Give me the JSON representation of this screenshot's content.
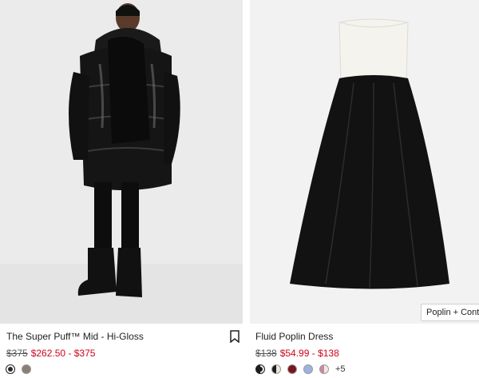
{
  "products": [
    {
      "name": "The Super Puff™ Mid - Hi-Gloss",
      "price_original": "$375",
      "price_sale": "$262.50 - $375",
      "swatches": [
        {
          "color": "#2a2a2a",
          "selected": true
        },
        {
          "color": "#8a7f74",
          "selected": false
        }
      ],
      "bookmark_icon": "bookmark-icon"
    },
    {
      "name": "Fluid Poplin Dress",
      "price_original": "$138",
      "price_sale": "$54.99 - $138",
      "tag": "Poplin + Conto",
      "swatches": [
        {
          "color": "#1c1c1c",
          "color2": "#f0ece4",
          "selected": true
        },
        {
          "color": "#1c1c1c",
          "color2": "#efe6d8",
          "selected": false
        },
        {
          "color": "#7a1420",
          "selected": false
        },
        {
          "color": "#9cb3df",
          "selected": false
        },
        {
          "color": "#c98a9a",
          "color2": "#f1e7e3",
          "selected": false
        }
      ],
      "more_swatches": "+5"
    }
  ]
}
